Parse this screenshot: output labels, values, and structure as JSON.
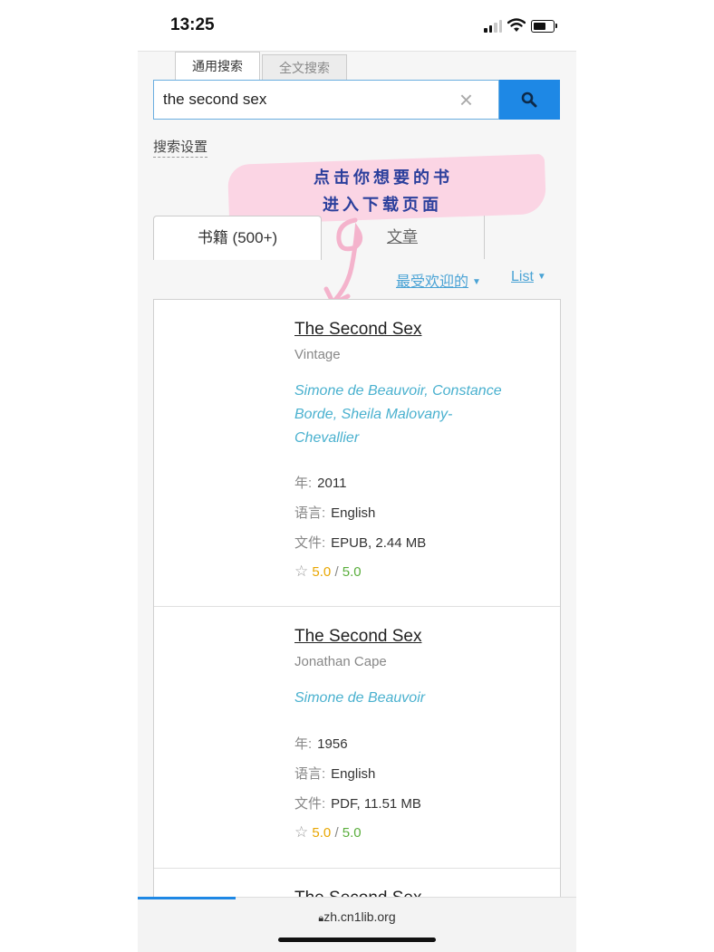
{
  "status": {
    "time": "13:25"
  },
  "search_tabs": {
    "general": "通用搜索",
    "fulltext": "全文搜索"
  },
  "search": {
    "value": "the second sex",
    "clear": "×"
  },
  "settings_link": "搜索设置",
  "annotation": {
    "line1": "点击你想要的书",
    "line2": "进入下载页面"
  },
  "result_tabs": {
    "books": "书籍 (500+)",
    "articles": "文章"
  },
  "sort": {
    "label": "最受欢迎的",
    "view": "List"
  },
  "labels": {
    "year": "年:",
    "language": "语言:",
    "file": "文件:"
  },
  "books": [
    {
      "title": "The Second Sex",
      "publisher": "Vintage",
      "authors": "Simone de Beauvoir, Constance Borde, Sheila Malovany-Chevallier",
      "year": "2011",
      "language": "English",
      "file": "EPUB, 2.44 MB",
      "rating": "5.0",
      "rating_max": "5.0"
    },
    {
      "title": "The Second Sex",
      "publisher": "Jonathan Cape",
      "authors": "Simone de Beauvoir",
      "year": "1956",
      "language": "English",
      "file": "PDF, 11.51 MB",
      "rating": "5.0",
      "rating_max": "5.0"
    },
    {
      "title": "The Second Sex"
    }
  ],
  "browser": {
    "url": "zh.cn1lib.org"
  },
  "colors": {
    "accent": "#1e88e5",
    "link": "#4ab1cf",
    "rating": "#e8a600",
    "rating_max": "#5aae3c",
    "annotation_bg": "#fbd3e3"
  }
}
